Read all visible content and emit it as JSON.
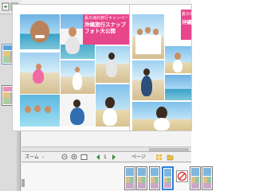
{
  "app": {
    "title": ""
  },
  "left_panel": {
    "icons": [
      "add-page-icon",
      "delete-page-icon"
    ],
    "thumbnails": [
      {
        "name": "page-thumbnail-1",
        "selected": true
      },
      {
        "name": "page-thumbnail-2",
        "selected": false
      }
    ]
  },
  "spread": {
    "left_page": {
      "title_small": "夏の海外旅行キャンペーン",
      "title_main": "沖縄旅行スナップフォト大公開"
    },
    "right_page": {
      "title_small": "夏の海外",
      "title_main": "沖縄旅行スナ"
    },
    "colors": {
      "accent": "#e8468b",
      "page": "#ffffff"
    }
  },
  "bottom_bar": {
    "zoom_label": "ズーム",
    "zoom_value": "-",
    "page_label": "1",
    "layout_label": "ページ",
    "icons": [
      "zoom-out-icon",
      "zoom-in-icon",
      "fit-page-icon",
      "prev-page-icon",
      "next-page-icon",
      "grid-icon",
      "folder-icon"
    ]
  },
  "filmstrip": {
    "items": [
      "film-page-1",
      "film-page-2",
      "film-page-3",
      "film-page-4",
      "film-page-5",
      "film-page-6"
    ],
    "selected_index": 3,
    "no_entry_icon": "no-entry-icon"
  }
}
